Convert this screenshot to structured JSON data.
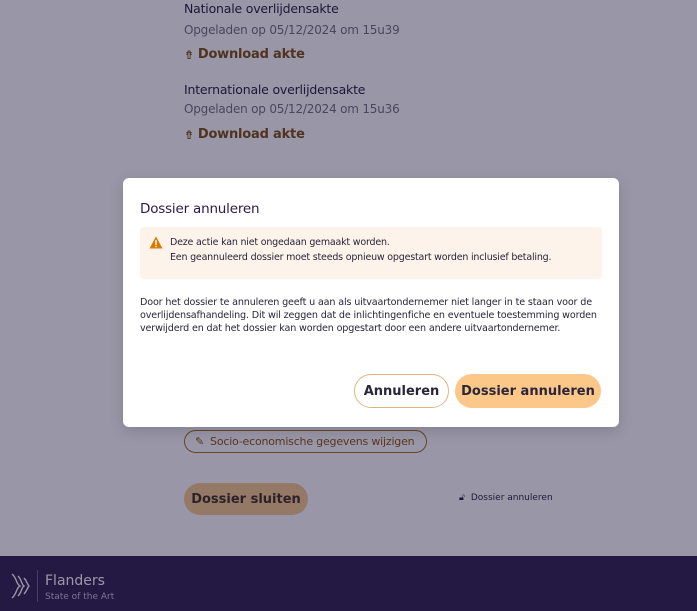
{
  "documents": [
    {
      "title": "Nationale overlijdensakte",
      "uploaded": "Opgeladen op 05/12/2024 om 15u39",
      "download_label": "Download akte"
    },
    {
      "title": "Internationale overlijdensakte",
      "uploaded": "Opgeladen op 05/12/2024 om 15u36",
      "download_label": "Download akte"
    }
  ],
  "actions": {
    "socio_label": "Socio-economische gegevens wijzigen",
    "close_label": "Dossier sluiten",
    "cancel_link_label": "Dossier annuleren"
  },
  "footer": {
    "title": "Flanders",
    "subtitle": "State of the Art"
  },
  "modal": {
    "title": "Dossier annuleren",
    "warning_line1": "Deze actie kan niet ongedaan gemaakt worden.",
    "warning_line2": "Een geannuleerd dossier moet steeds opnieuw opgestart worden inclusief betaling.",
    "body": "Door het dossier te annuleren geeft u aan als uitvaartondernemer niet langer in te staan voor de overlijdensafhandeling. Dit wil zeggen dat de inlichtingenfiche en eventuele toestemming worden verwijderd en dat het dossier kan worden opgestart door een andere uitvaartondernemer.",
    "cancel_button": "Annuleren",
    "confirm_button": "Dossier annuleren"
  },
  "colors": {
    "accent": "#fcc88a",
    "warning": "#d97a00",
    "footer_bg": "#2a1a4a",
    "overlay": "#1d183c"
  }
}
